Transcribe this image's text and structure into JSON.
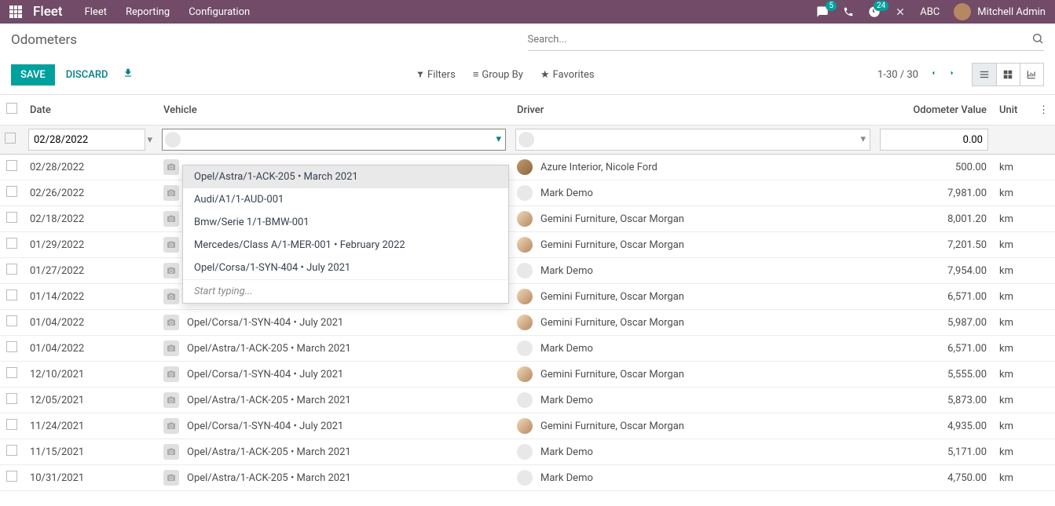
{
  "app": {
    "brand": "Fleet"
  },
  "nav": {
    "links": [
      "Fleet",
      "Reporting",
      "Configuration"
    ],
    "msg_badge": "5",
    "activity_badge": "24",
    "company": "ABC",
    "user": "Mitchell Admin"
  },
  "controlpanel": {
    "breadcrumb": "Odometers",
    "search_placeholder": "Search...",
    "save": "SAVE",
    "discard": "DISCARD",
    "filters": "Filters",
    "group_by": "Group By",
    "favorites": "Favorites",
    "pager": "1-30 / 30"
  },
  "table": {
    "headers": {
      "date": "Date",
      "vehicle": "Vehicle",
      "driver": "Driver",
      "value": "Odometer Value",
      "unit": "Unit"
    },
    "edit_row": {
      "date": "02/28/2022",
      "value": "0.00"
    },
    "rows": [
      {
        "date": "02/28/2022",
        "vehicle": "",
        "driver": "Azure Interior, Nicole Ford",
        "avatar": "real",
        "value": "500.00",
        "unit": "km"
      },
      {
        "date": "02/26/2022",
        "vehicle": "",
        "driver": "Mark Demo",
        "avatar": "",
        "value": "7,981.00",
        "unit": "km"
      },
      {
        "date": "02/18/2022",
        "vehicle": "",
        "driver": "Gemini Furniture, Oscar Morgan",
        "avatar": "gemini",
        "value": "8,001.20",
        "unit": "km"
      },
      {
        "date": "01/29/2022",
        "vehicle": "",
        "driver": "Gemini Furniture, Oscar Morgan",
        "avatar": "gemini",
        "value": "7,201.50",
        "unit": "km"
      },
      {
        "date": "01/27/2022",
        "vehicle": "",
        "driver": "Mark Demo",
        "avatar": "",
        "value": "7,954.00",
        "unit": "km"
      },
      {
        "date": "01/14/2022",
        "vehicle": "Opel/Corsa/1-SYN-404 • July 2021",
        "driver": "Gemini Furniture, Oscar Morgan",
        "avatar": "gemini",
        "value": "6,571.00",
        "unit": "km"
      },
      {
        "date": "01/04/2022",
        "vehicle": "Opel/Corsa/1-SYN-404 • July 2021",
        "driver": "Gemini Furniture, Oscar Morgan",
        "avatar": "gemini",
        "value": "5,987.00",
        "unit": "km"
      },
      {
        "date": "01/04/2022",
        "vehicle": "Opel/Astra/1-ACK-205 • March 2021",
        "driver": "Mark Demo",
        "avatar": "",
        "value": "6,571.00",
        "unit": "km"
      },
      {
        "date": "12/10/2021",
        "vehicle": "Opel/Corsa/1-SYN-404 • July 2021",
        "driver": "Gemini Furniture, Oscar Morgan",
        "avatar": "gemini",
        "value": "5,555.00",
        "unit": "km"
      },
      {
        "date": "12/05/2021",
        "vehicle": "Opel/Astra/1-ACK-205 • March 2021",
        "driver": "Mark Demo",
        "avatar": "",
        "value": "5,873.00",
        "unit": "km"
      },
      {
        "date": "11/24/2021",
        "vehicle": "Opel/Corsa/1-SYN-404 • July 2021",
        "driver": "Gemini Furniture, Oscar Morgan",
        "avatar": "gemini",
        "value": "4,935.00",
        "unit": "km"
      },
      {
        "date": "11/15/2021",
        "vehicle": "Opel/Astra/1-ACK-205 • March 2021",
        "driver": "Mark Demo",
        "avatar": "",
        "value": "5,171.00",
        "unit": "km"
      },
      {
        "date": "10/31/2021",
        "vehicle": "Opel/Astra/1-ACK-205 • March 2021",
        "driver": "Mark Demo",
        "avatar": "",
        "value": "4,750.00",
        "unit": "km"
      }
    ]
  },
  "dropdown": {
    "options": [
      "Opel/Astra/1-ACK-205 • March 2021",
      "Audi/A1/1-AUD-001",
      "Bmw/Serie 1/1-BMW-001",
      "Mercedes/Class A/1-MER-001 • February 2022",
      "Opel/Corsa/1-SYN-404 • July 2021"
    ],
    "footer": "Start typing..."
  }
}
